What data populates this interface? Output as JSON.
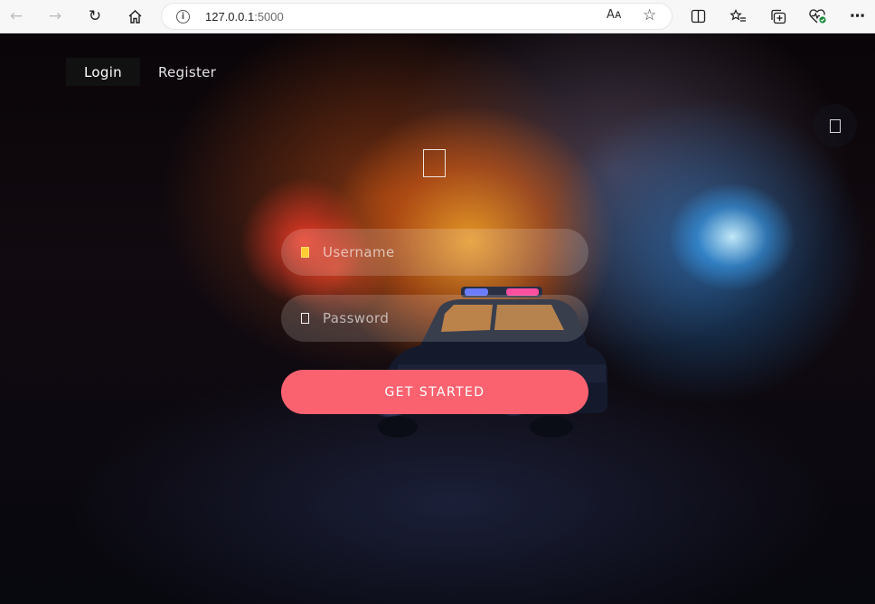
{
  "browser": {
    "url_host": "127.0.0.1",
    "url_port": ":5000",
    "icons": {
      "back": "arrow-left-icon",
      "forward": "arrow-right-icon",
      "refresh": "refresh-icon",
      "home": "home-icon",
      "info": "info-icon",
      "read_aloud": "read-aloud-icon",
      "favorite": "star-icon",
      "split_screen": "split-screen-icon",
      "favorites": "favorites-list-icon",
      "collections": "collections-icon",
      "browser_essentials": "heart-pulse-icon",
      "more": "more-icon"
    },
    "read_aloud_glyph": "Aᴀ"
  },
  "nav": {
    "login_label": "Login",
    "register_label": "Register"
  },
  "form": {
    "username_placeholder": "Username",
    "password_placeholder": "Password",
    "submit_label": "GET STARTED"
  },
  "colors": {
    "accent": "#fb6270",
    "tab_active_bg": "#121214"
  }
}
